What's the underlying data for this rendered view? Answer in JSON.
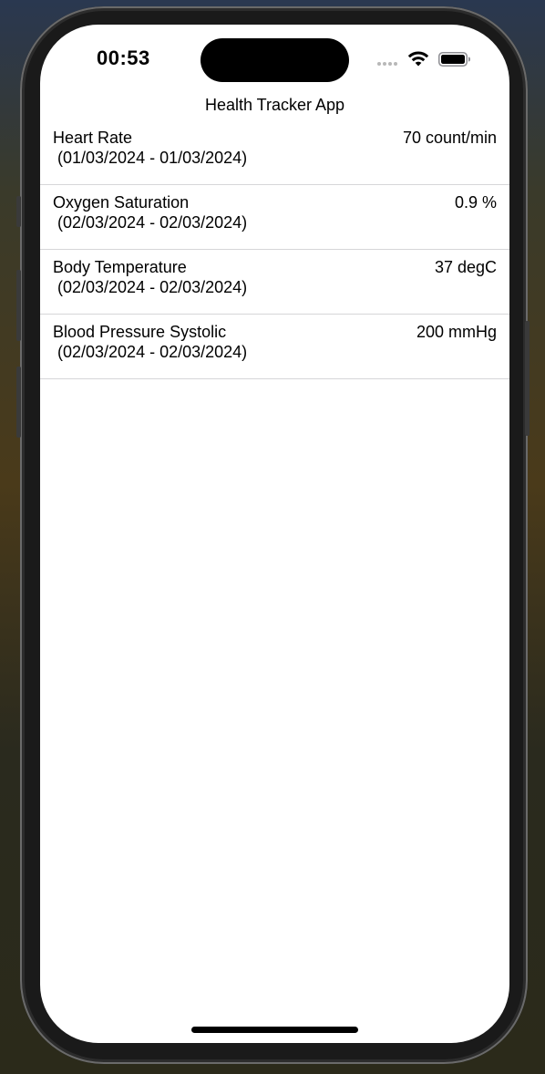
{
  "status_bar": {
    "time": "00:53"
  },
  "nav": {
    "title": "Health Tracker App"
  },
  "records": [
    {
      "name": "Heart Rate",
      "value": "70 count/min",
      "range": " (01/03/2024 - 01/03/2024)"
    },
    {
      "name": "Oxygen Saturation",
      "value": "0.9 %",
      "range": " (02/03/2024 - 02/03/2024)"
    },
    {
      "name": "Body Temperature",
      "value": "37 degC",
      "range": " (02/03/2024 - 02/03/2024)"
    },
    {
      "name": "Blood Pressure Systolic",
      "value": "200 mmHg",
      "range": " (02/03/2024 - 02/03/2024)"
    }
  ],
  "icons": {
    "signal": "cellular-signal-icon",
    "wifi": "wifi-icon",
    "battery": "battery-icon"
  },
  "colors": {
    "screen_background": "#ffffff",
    "separator": "#d6d6d8",
    "text": "#000000"
  }
}
